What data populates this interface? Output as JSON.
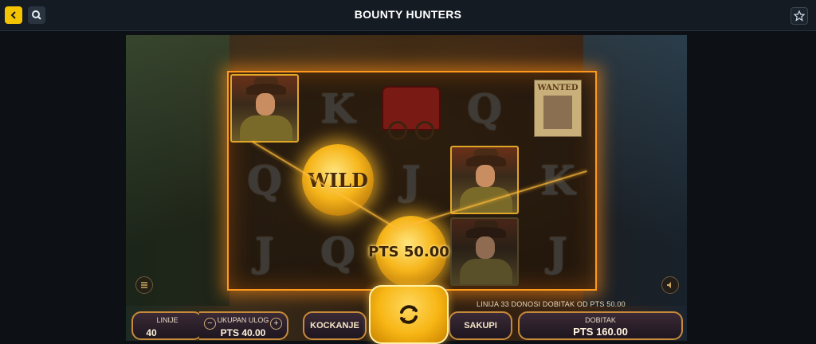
{
  "header": {
    "title": "BOUNTY HUNTERS",
    "back_icon": "chevron-left-icon",
    "search_icon": "search-icon",
    "favorite_icon": "star-icon"
  },
  "colors": {
    "accent": "#f5c400",
    "frame_glow": "#ff9a1f",
    "panel_border": "#c78a3a"
  },
  "reels": {
    "columns": [
      [
        "hunter",
        "Q",
        "J"
      ],
      [
        "K",
        "WILD",
        "Q"
      ],
      [
        "stagecoach",
        "J",
        "coin"
      ],
      [
        "Q",
        "hunter",
        "hunter"
      ],
      [
        "wanted-poster",
        "K",
        "J"
      ]
    ],
    "wild_label": "WILD",
    "coin_win_label": "PTS 50.00"
  },
  "message": "LINIJA 33 DONOSI DOBITAK OD PTS 50.00",
  "controls": {
    "lines_label": "LINIJE",
    "lines_value": "40",
    "stake_label": "UKUPAN ULOG",
    "stake_value": "PTS 40.00",
    "minus": "−",
    "plus": "+",
    "gamble_label": "KOCKANJE",
    "collect_label": "SAKUPI",
    "win_label": "DOBITAK",
    "win_value": "PTS 160.00",
    "spin_icon": "refresh-icon",
    "menu_icon": "menu-icon",
    "sound_icon": "speaker-icon"
  }
}
